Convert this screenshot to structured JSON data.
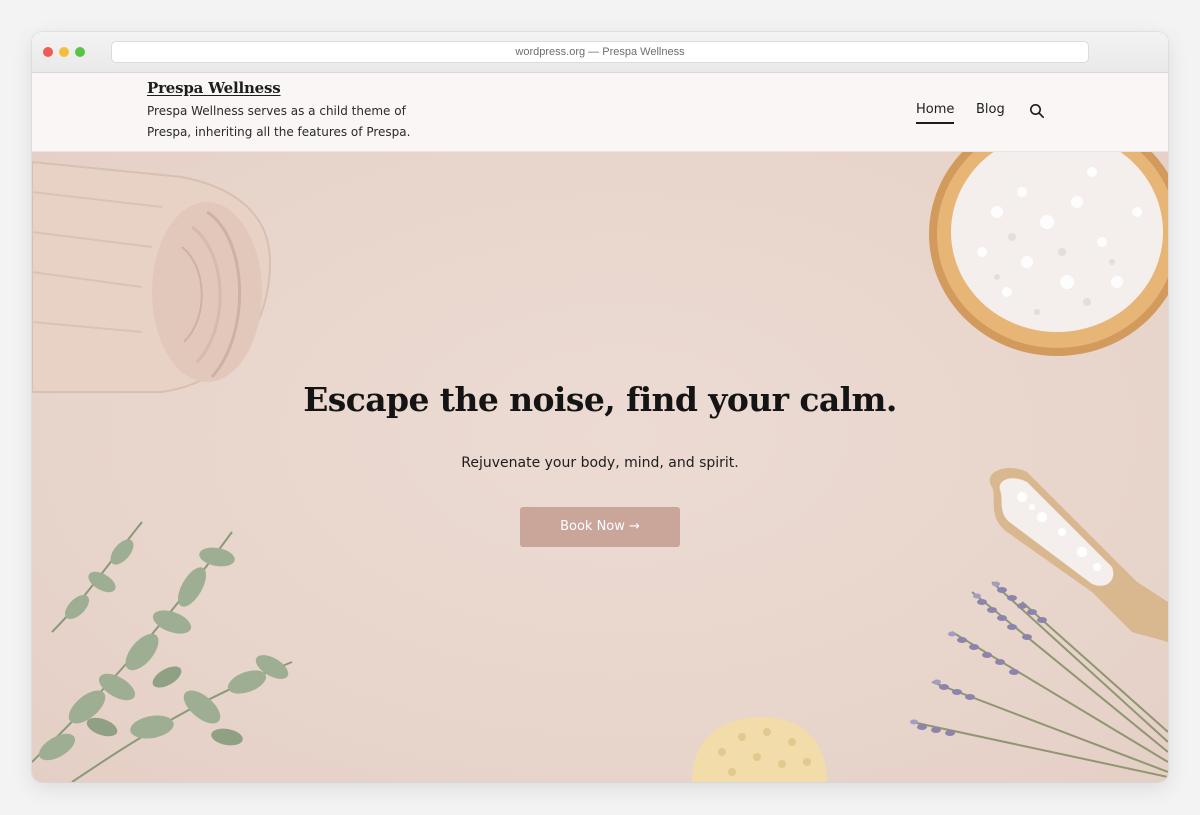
{
  "browser": {
    "url": "wordpress.org — Prespa Wellness"
  },
  "header": {
    "site_title": "Prespa Wellness",
    "tagline": "Prespa Wellness serves as a child theme of Prespa, inheriting all the features of Prespa.",
    "nav": [
      {
        "label": "Home",
        "active": true
      },
      {
        "label": "Blog",
        "active": false
      }
    ],
    "search_icon": "search-icon"
  },
  "hero": {
    "title": "Escape the noise, find your calm.",
    "subtitle": "Rejuvenate your body, mind, and spirit.",
    "button_label": "Book Now →"
  },
  "colors": {
    "header_bg": "#faf6f5",
    "hero_bg": "#e9d7ce",
    "button_bg": "#c9a59a",
    "text": "#141414"
  }
}
